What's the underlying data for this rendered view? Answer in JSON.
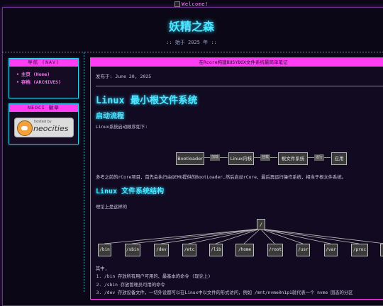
{
  "header": {
    "welcome_alt": "Welcome!",
    "site_title": "妖精之森",
    "subtitle": ":: 始于 2025 年 ::"
  },
  "sidebar": {
    "nav_title": "导航 (NAV)",
    "nav_items": [
      {
        "label": "主页 (Home)"
      },
      {
        "label": "存档 (ARCHIVES)"
      }
    ],
    "badge_title": "NEOCI 徽章",
    "badge": {
      "hosted_by": "hosted by",
      "name": "neocities"
    }
  },
  "article": {
    "window_title": "在Rcore构建BUSYBOX文件系统最简单笔记",
    "posted": "发布于: June 20, 2025",
    "title": "Linux 最小根文件系统",
    "section1": "启动流程",
    "p1": "Linux系统启动顺序如下:",
    "boot_flow": {
      "boxes": [
        "Bootloader",
        "Linux内核",
        "根文件系统",
        "应用"
      ],
      "arrows": [
        "加载",
        "挂载",
        "运行"
      ]
    },
    "p2": "多考之前的rCore项目，首先会执行由QEMU提供的BootLoader,然后启动rCore，最后再运行操作系统，相当于根文件系统。",
    "section2": "Linux 文件系统结构",
    "p3": "理论上是这样的",
    "tree": {
      "root": "/",
      "dirs": [
        "/bin",
        "/sbin",
        "/dev",
        "/etc",
        "/lib",
        "/home",
        "/root",
        "/usr",
        "/var",
        "/proc"
      ]
    },
    "p4": "其中,",
    "list": [
      "/bin 存放所有用户可用的、最基本的命令 (现论上)",
      "/sbin 存放管理员可用的命令",
      "/dev 存放设备文件，一切外设都可以在Linux中以文件的形式访问，例如 /mnt/nvme0n1p1就代表一个 nvme 固态的分区"
    ]
  }
}
